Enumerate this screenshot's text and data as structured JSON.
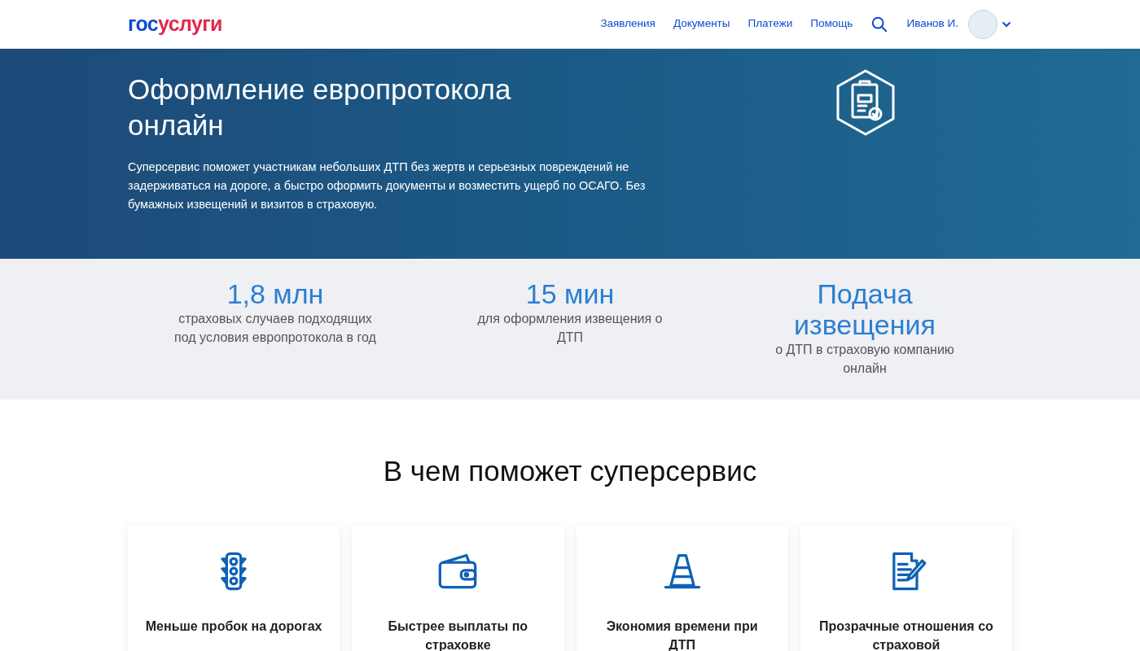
{
  "header": {
    "logo": {
      "part_1": "гос",
      "part_2": "услуги"
    },
    "nav": [
      "Заявления",
      "Документы",
      "Платежи",
      "Помощь"
    ],
    "user": "Иванов И."
  },
  "hero": {
    "title": "Оформление европротокола онлайн",
    "text": "Суперсервис поможет участникам небольших ДТП без жертв и серьезных повреждений не задерживаться на дороге, а быстро оформить документы и возместить ущерб по ОСАГО. Без бумажных извещений и визитов в страховую."
  },
  "stats": [
    {
      "value": "1,8 млн",
      "caption": "страховых случаев подходящих под условия европротокола в год"
    },
    {
      "value": "15 мин",
      "caption": "для оформления извещения о ДТП"
    },
    {
      "value": "Подача извещения",
      "caption": "о ДТП в страховую компанию онлайн"
    }
  ],
  "section": {
    "title": "В чем поможет суперсервис"
  },
  "cards": [
    {
      "kind": "traffic-light",
      "title": "Меньше пробок на дорогах"
    },
    {
      "kind": "wallet",
      "title": "Быстрее выплаты по страховке"
    },
    {
      "kind": "cone",
      "title": "Экономия времени при ДТП"
    },
    {
      "kind": "document",
      "title": "Прозрачные отношения со страховой"
    }
  ]
}
